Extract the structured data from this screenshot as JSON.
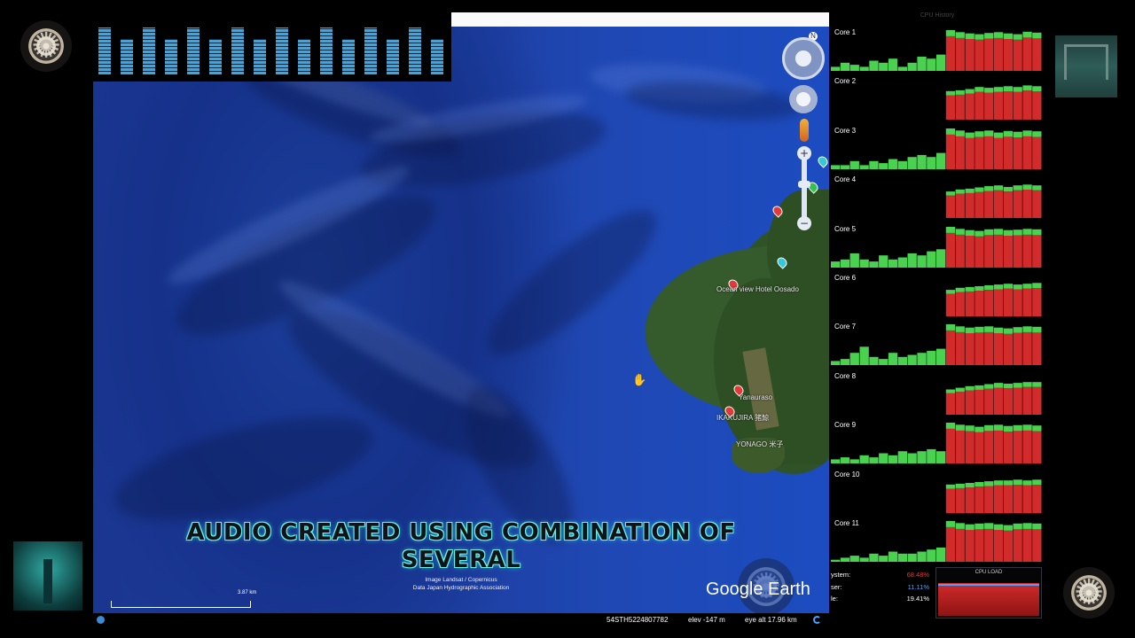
{
  "earth": {
    "caption_line1": "AUDIO CREATED USING COMBINATION OF",
    "caption_line2": "SEVERAL",
    "attribution_line1": "Image Landsat / Copernicus",
    "attribution_line2": "Data Japan Hydrographic Association",
    "logo": "Google Earth",
    "scale_label": "3.87 km",
    "coordinates": "54STH5224807782",
    "elevation": "elev -147 m",
    "eye_alt": "eye alt 17.96 km",
    "zoom_in": "+",
    "zoom_out": "−",
    "north_label": "N",
    "places": [
      {
        "label": "Ocean view Hotel Oosado"
      },
      {
        "label": "Yanauraso"
      },
      {
        "label": "IKAKUJIRA 猪鯨"
      },
      {
        "label": "YONAGO 米子"
      }
    ],
    "icons": [
      "look-control-icon",
      "move-control-icon",
      "pegman-icon",
      "hand-cursor-icon",
      "loading-icon"
    ]
  },
  "visualizer": {
    "levels": [
      0.85,
      0.65,
      0.85,
      0.65,
      0.85,
      0.65,
      0.85,
      0.65,
      0.85,
      0.65,
      0.85,
      0.65,
      0.85,
      0.65,
      0.85,
      0.65
    ]
  },
  "cpu_history": {
    "title": "CPU History",
    "cores": [
      {
        "label": "Core 1",
        "history": [
          0.1,
          0.2,
          0.15,
          0.1,
          0.25,
          0.2,
          0.3,
          0.1,
          0.2,
          0.35,
          0.3,
          0.4,
          1,
          0.95,
          0.92,
          0.9,
          0.93,
          0.95,
          0.92,
          0.9,
          0.96,
          0.94
        ]
      },
      {
        "label": "Core 2",
        "history": [
          0,
          0,
          0,
          0,
          0,
          0,
          0,
          0,
          0,
          0,
          0,
          0,
          0.7,
          0.72,
          0.75,
          0.8,
          0.78,
          0.8,
          0.82,
          0.8,
          0.84,
          0.82
        ]
      },
      {
        "label": "Core 3",
        "history": [
          0.1,
          0.1,
          0.2,
          0.1,
          0.2,
          0.15,
          0.25,
          0.2,
          0.3,
          0.35,
          0.3,
          0.4,
          1,
          0.95,
          0.9,
          0.93,
          0.95,
          0.9,
          0.94,
          0.92,
          0.95,
          0.93
        ]
      },
      {
        "label": "Core 4",
        "history": [
          0,
          0,
          0,
          0,
          0,
          0,
          0,
          0,
          0,
          0,
          0,
          0,
          0.65,
          0.7,
          0.72,
          0.75,
          0.78,
          0.8,
          0.76,
          0.8,
          0.82,
          0.8
        ]
      },
      {
        "label": "Core 5",
        "history": [
          0.15,
          0.2,
          0.35,
          0.2,
          0.15,
          0.3,
          0.2,
          0.25,
          0.35,
          0.3,
          0.4,
          0.45,
          1,
          0.95,
          0.92,
          0.9,
          0.94,
          0.95,
          0.92,
          0.93,
          0.95,
          0.94
        ]
      },
      {
        "label": "Core 6",
        "history": [
          0,
          0,
          0,
          0,
          0,
          0,
          0,
          0,
          0,
          0,
          0,
          0,
          0.65,
          0.7,
          0.72,
          0.74,
          0.76,
          0.78,
          0.8,
          0.78,
          0.8,
          0.82
        ]
      },
      {
        "label": "Core 7",
        "history": [
          0.1,
          0.15,
          0.3,
          0.45,
          0.2,
          0.15,
          0.3,
          0.2,
          0.25,
          0.3,
          0.35,
          0.4,
          1,
          0.95,
          0.92,
          0.94,
          0.95,
          0.92,
          0.9,
          0.93,
          0.95,
          0.94
        ]
      },
      {
        "label": "Core 8",
        "history": [
          0,
          0,
          0,
          0,
          0,
          0,
          0,
          0,
          0,
          0,
          0,
          0,
          0.62,
          0.66,
          0.7,
          0.72,
          0.75,
          0.78,
          0.76,
          0.78,
          0.8,
          0.8
        ]
      },
      {
        "label": "Core 9",
        "history": [
          0.1,
          0.15,
          0.1,
          0.2,
          0.15,
          0.25,
          0.2,
          0.3,
          0.25,
          0.3,
          0.35,
          0.3,
          1,
          0.95,
          0.93,
          0.9,
          0.94,
          0.95,
          0.92,
          0.94,
          0.95,
          0.93
        ]
      },
      {
        "label": "Core 10",
        "history": [
          0,
          0,
          0,
          0,
          0,
          0,
          0,
          0,
          0,
          0,
          0,
          0,
          0.7,
          0.72,
          0.74,
          0.76,
          0.78,
          0.8,
          0.8,
          0.82,
          0.8,
          0.82
        ]
      },
      {
        "label": "Core 11",
        "history": [
          0.05,
          0.1,
          0.15,
          0.1,
          0.2,
          0.15,
          0.25,
          0.2,
          0.2,
          0.25,
          0.3,
          0.35,
          1,
          0.95,
          0.92,
          0.94,
          0.95,
          0.92,
          0.9,
          0.94,
          0.95,
          0.94
        ]
      }
    ]
  },
  "cpu_load": {
    "title": "CPU LOAD",
    "rows": [
      {
        "key": "ystem:",
        "value": "68.48%",
        "color": "#e23a3a"
      },
      {
        "key": "ser:",
        "value": "11.11%",
        "color": "#4aa3ff"
      },
      {
        "key": "le:",
        "value": "19.41%",
        "color": "#ffffff"
      }
    ],
    "load": 0.8
  },
  "colors": {
    "caption_outline": "#6ff3e4",
    "graph_green": "#49d14f",
    "graph_red": "#d12b2b",
    "ocean": "#1d3d9e"
  }
}
